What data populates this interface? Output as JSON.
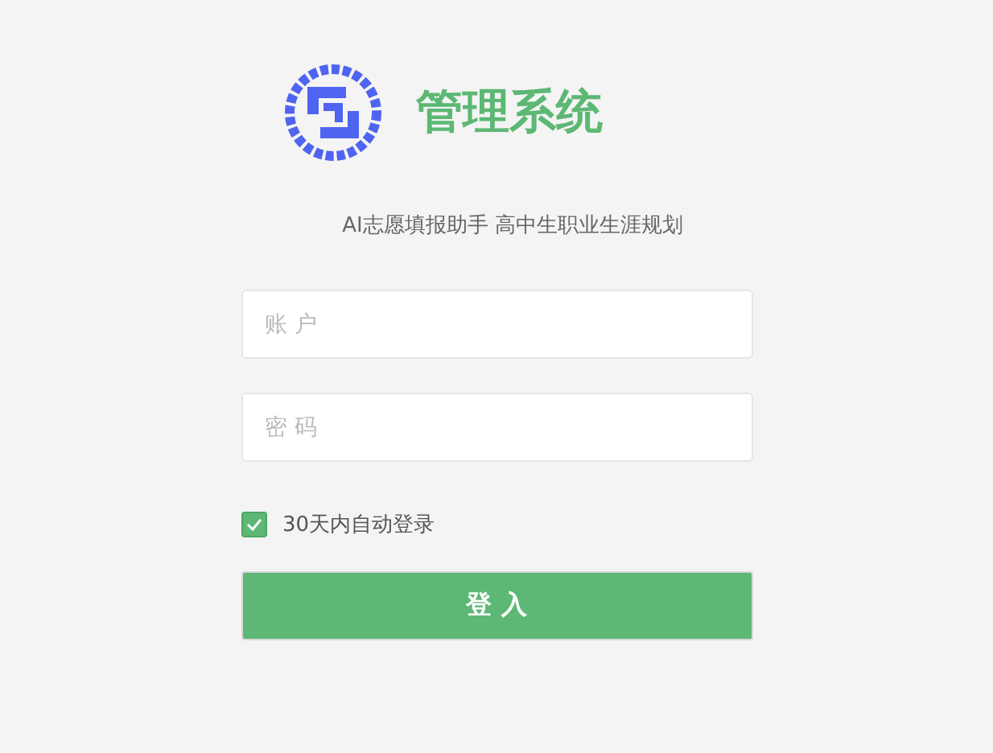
{
  "brand": {
    "title": "管理系统",
    "subtitle": "AI志愿填报助手 高中生职业生涯规划"
  },
  "fields": [
    {
      "placeholder": "账 户"
    },
    {
      "placeholder": "密 码"
    }
  ],
  "remember": {
    "label": "30天内自动登录",
    "checked": true
  },
  "submit": {
    "label": "登 入"
  }
}
